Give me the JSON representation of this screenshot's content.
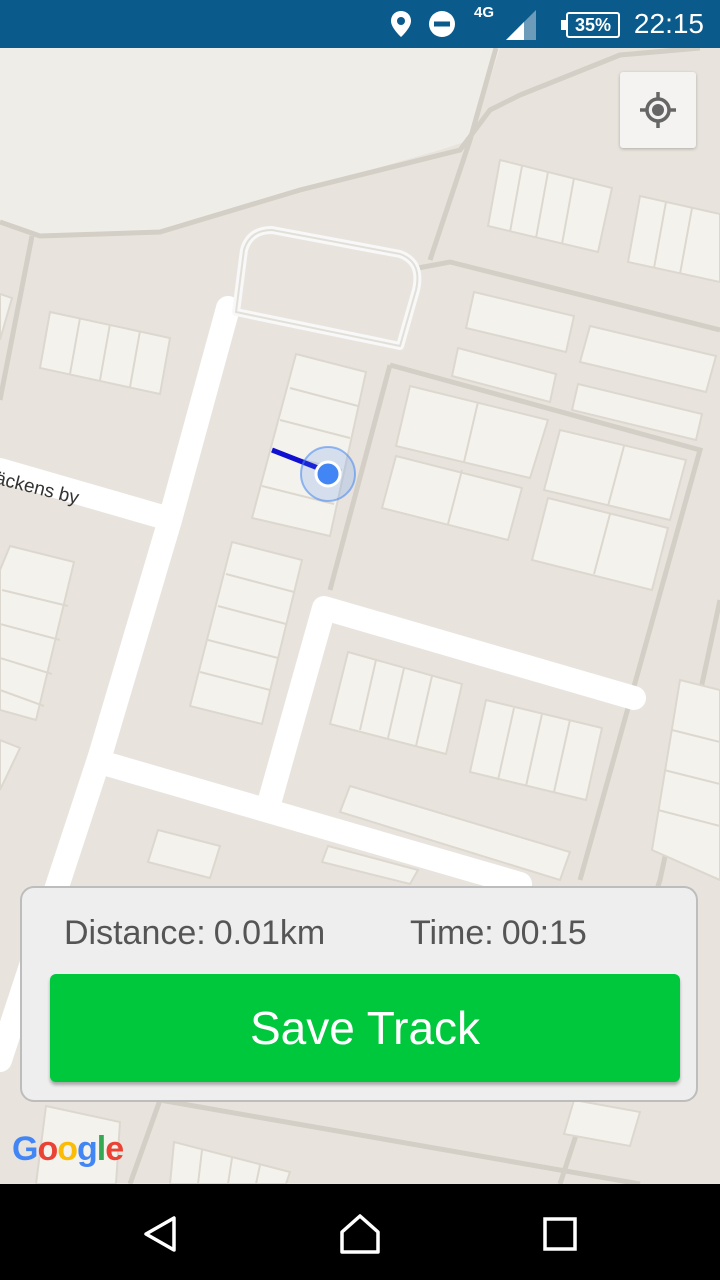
{
  "status_bar": {
    "network": "4G",
    "battery": "35%",
    "time": "22:15"
  },
  "map": {
    "street_label": "äckens by",
    "attribution": "Google"
  },
  "tracking_panel": {
    "distance_label": "Distance:",
    "distance_value": "0.01km",
    "time_label": "Time:",
    "time_value": "00:15",
    "save_button": "Save Track"
  },
  "colors": {
    "status_bar": "#0a5a8c",
    "save_button": "#00c83c",
    "track_line": "#1010d0",
    "location_dot": "#4285f4"
  }
}
